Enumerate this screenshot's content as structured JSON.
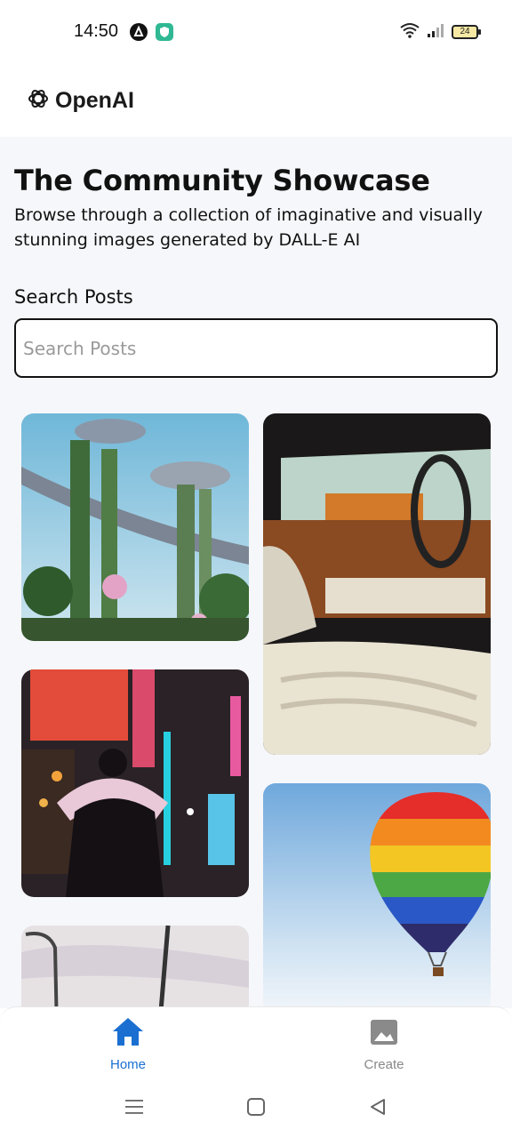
{
  "status_bar": {
    "time": "14:50",
    "battery": "24",
    "icons": [
      "notification-a-icon",
      "shield-app-icon",
      "wifi-icon",
      "signal-icon",
      "battery-icon"
    ]
  },
  "header": {
    "logo_icon": "openai-logo-icon",
    "logo_text": "OpenAI"
  },
  "main": {
    "title": "The Community Showcase",
    "subtitle": "Browse through a collection of imaginative and visually stunning images generated by DALL-E AI",
    "search": {
      "label": "Search Posts",
      "placeholder": "Search Posts",
      "value": ""
    },
    "gallery": [
      {
        "id": "futuristic-garden-city"
      },
      {
        "id": "luxury-car-interior"
      },
      {
        "id": "neon-city-night"
      },
      {
        "id": "hot-air-balloon"
      },
      {
        "id": "sky-streetlight"
      }
    ]
  },
  "bottom_nav": {
    "items": [
      {
        "label": "Home",
        "icon": "home-icon",
        "active": true
      },
      {
        "label": "Create",
        "icon": "image-icon",
        "active": false
      }
    ]
  },
  "system_nav": {
    "icons": [
      "menu-icon",
      "home-square-icon",
      "back-icon"
    ]
  },
  "colors": {
    "accent": "#1a6fd1",
    "background": "#f6f7fb",
    "inactive": "#888888"
  }
}
